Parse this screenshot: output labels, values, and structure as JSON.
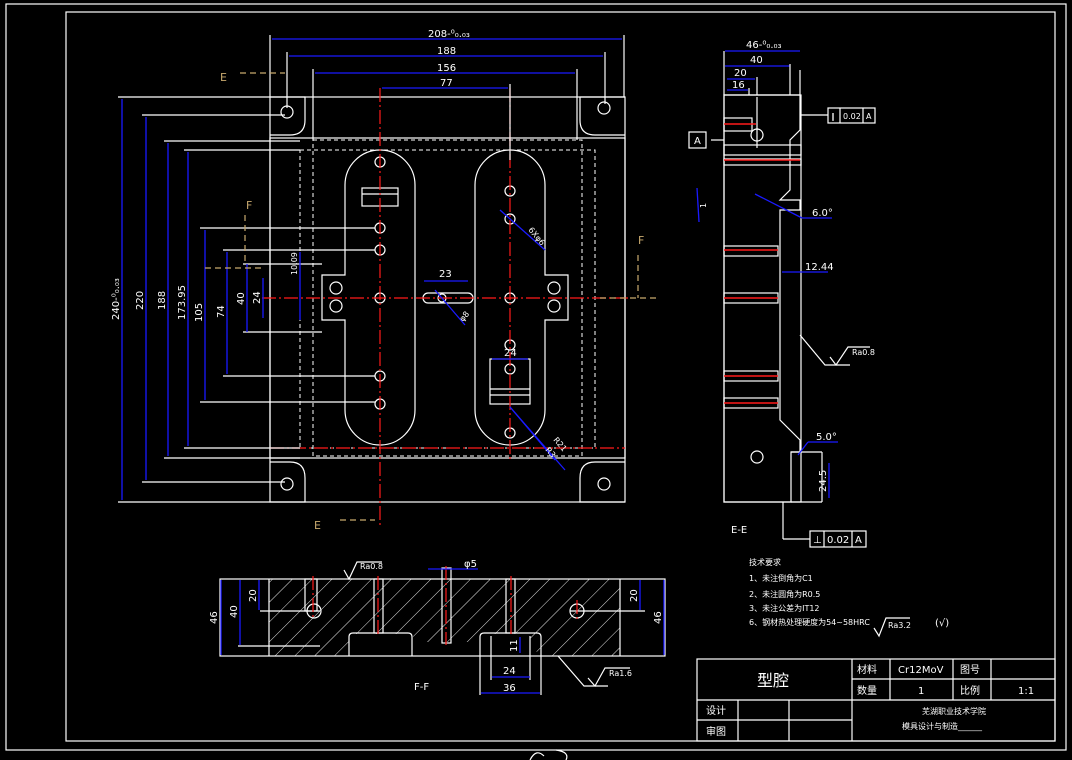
{
  "colors": {
    "background": "#000000",
    "outline": "#ffffff",
    "dimension": "#1a1aff",
    "centerline": "#ff1a1a",
    "section_marker": "#c8a96e"
  },
  "plan_view": {
    "section_marks": {
      "E_top": "E",
      "E_bottom": "E",
      "F_left": "F",
      "F_right": "F"
    },
    "dims_top": [
      "208-⁰₀.₀₃",
      "188",
      "156",
      "77"
    ],
    "dims_left": [
      "240-⁰₀.₀₃",
      "220",
      "188",
      "173.95",
      "105",
      "74",
      "40",
      "24",
      "10.09"
    ],
    "dims_inner": [
      "23",
      "φ8",
      "6Xφ6",
      "24",
      "R21",
      "R3"
    ]
  },
  "side_view": {
    "title": "E-E",
    "dims": [
      "46-⁰₀.₀₃",
      "40",
      "20",
      "16",
      "6.0°",
      "12.44",
      "5.0°",
      "24.5",
      "1"
    ],
    "datum": "A",
    "tol_top": {
      "symbol": "∥",
      "value": "0.02",
      "datum": "A"
    },
    "tol_bottom": {
      "symbol": "⊥",
      "value": "0.02",
      "datum": "A"
    },
    "roughness": "Ra0.8"
  },
  "section_view": {
    "title": "F-F",
    "dims": [
      "46",
      "40",
      "20",
      "20",
      "46",
      "φ5",
      "11",
      "24",
      "36"
    ],
    "roughness_top": "Ra0.8",
    "roughness_bottom": "Ra1.6"
  },
  "tech_requirements": {
    "title": "技术要求",
    "items": [
      "1、未注倒角为C1",
      "2、未注圆角为R0.5",
      "3、未注公差为IT12",
      "6、钢材热处理硬度为54~58HRC"
    ],
    "roughness": "Ra3.2",
    "other": "(√)"
  },
  "title_block": {
    "part_name": "型腔",
    "material_label": "材料",
    "material": "Cr12MoV",
    "drawing_no_label": "图号",
    "drawing_no": "",
    "quantity_label": "数量",
    "quantity": "1",
    "scale_label": "比例",
    "scale": "1:1",
    "design_label": "设计",
    "review_label": "审图",
    "school": "芜湖职业技术学院",
    "major": "模具设计与制造______"
  }
}
